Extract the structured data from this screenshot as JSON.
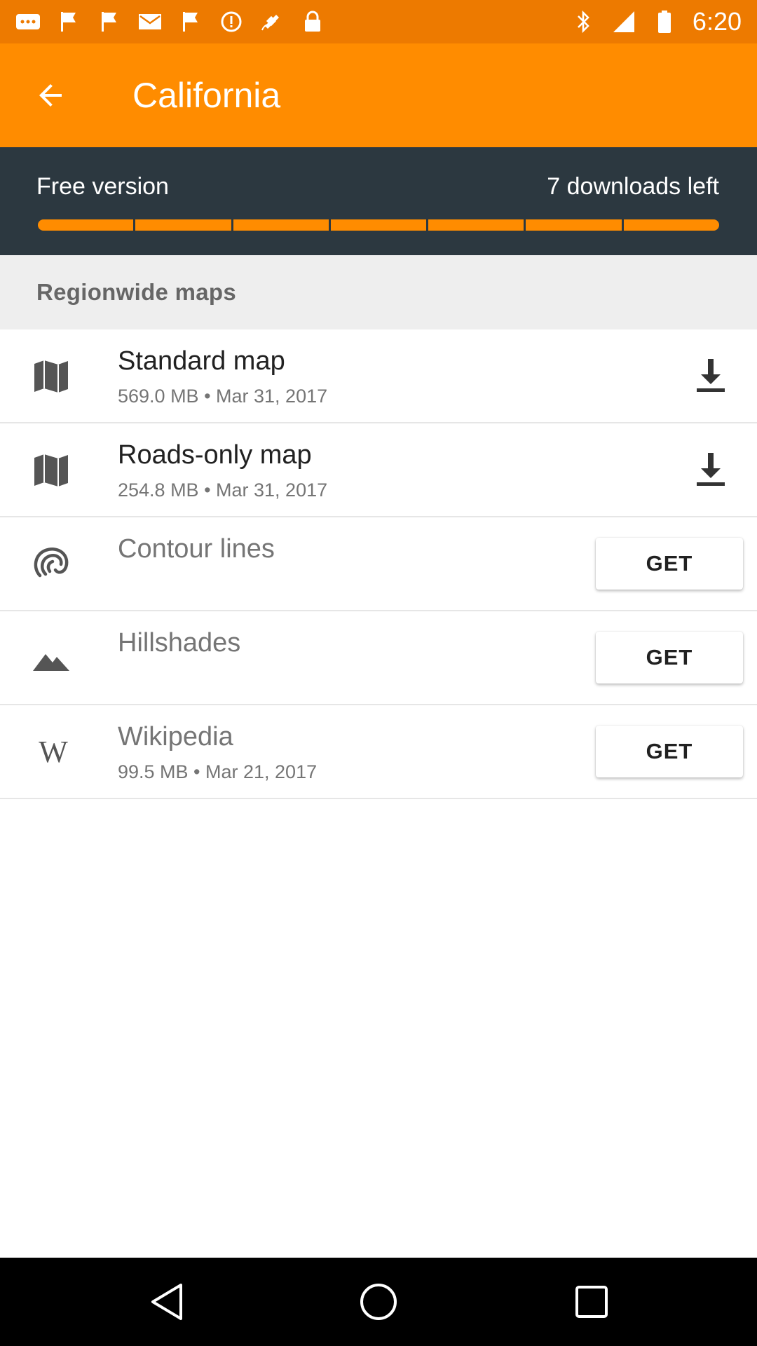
{
  "status_bar": {
    "time": "6:20",
    "left_icons": [
      "more-dots-icon",
      "flag-icon",
      "flag-icon",
      "mail-icon",
      "flag-icon",
      "alert-icon",
      "fake-gps-icon",
      "lock-icon"
    ],
    "right_icons": [
      "bluetooth-icon",
      "signal-icon",
      "battery-icon"
    ]
  },
  "app_bar": {
    "title": "California",
    "back_icon": "back-arrow-icon"
  },
  "version": {
    "label": "Free version",
    "downloads_left": "7 downloads left",
    "remaining_downloads": 7,
    "progress_color": "#ff8c00"
  },
  "section": {
    "title": "Regionwide maps"
  },
  "items": [
    {
      "icon": "map-icon",
      "title": "Standard map",
      "subtitle": "569.0 MB • Mar 31, 2017",
      "action": "download",
      "action_icon": "download-icon"
    },
    {
      "icon": "map-icon",
      "title": "Roads-only map",
      "subtitle": "254.8 MB • Mar 31, 2017",
      "action": "download",
      "action_icon": "download-icon"
    },
    {
      "icon": "contour-icon",
      "title": "Contour lines",
      "subtitle": "",
      "action": "get",
      "action_label": "GET"
    },
    {
      "icon": "mountain-icon",
      "title": "Hillshades",
      "subtitle": "",
      "action": "get",
      "action_label": "GET"
    },
    {
      "icon": "wikipedia-icon",
      "icon_text": "W",
      "title": "Wikipedia",
      "subtitle": "99.5 MB • Mar 21, 2017",
      "action": "get",
      "action_label": "GET"
    }
  ],
  "nav_bar": {
    "icons": [
      "back-triangle-icon",
      "home-circle-icon",
      "recents-square-icon"
    ]
  },
  "colors": {
    "status_bar": "#ed7a00",
    "app_bar": "#ff8c00",
    "version_panel": "#2c3840",
    "section_header": "#eeeeee"
  }
}
